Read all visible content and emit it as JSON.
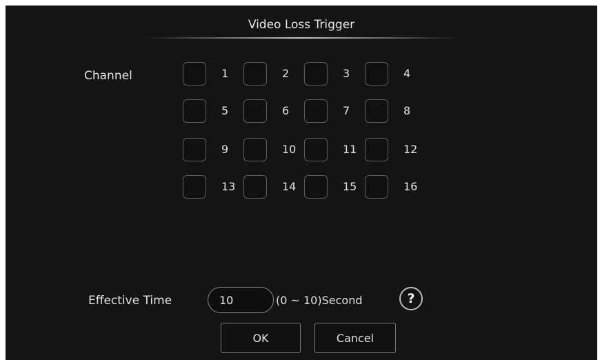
{
  "dialog": {
    "title": "Video Loss Trigger",
    "channel_label": "Channel",
    "channels": [
      {
        "label": "1",
        "checked": false
      },
      {
        "label": "2",
        "checked": false
      },
      {
        "label": "3",
        "checked": false
      },
      {
        "label": "4",
        "checked": false
      },
      {
        "label": "5",
        "checked": false
      },
      {
        "label": "6",
        "checked": false
      },
      {
        "label": "7",
        "checked": false
      },
      {
        "label": "8",
        "checked": false
      },
      {
        "label": "9",
        "checked": false
      },
      {
        "label": "10",
        "checked": false
      },
      {
        "label": "11",
        "checked": false
      },
      {
        "label": "12",
        "checked": false
      },
      {
        "label": "13",
        "checked": false
      },
      {
        "label": "14",
        "checked": false
      },
      {
        "label": "15",
        "checked": false
      },
      {
        "label": "16",
        "checked": false
      }
    ],
    "effective_time": {
      "label": "Effective Time",
      "value": "10",
      "range_text": "(0 ~ 10)Second"
    },
    "help_icon": "?",
    "ok_label": "OK",
    "cancel_label": "Cancel"
  }
}
